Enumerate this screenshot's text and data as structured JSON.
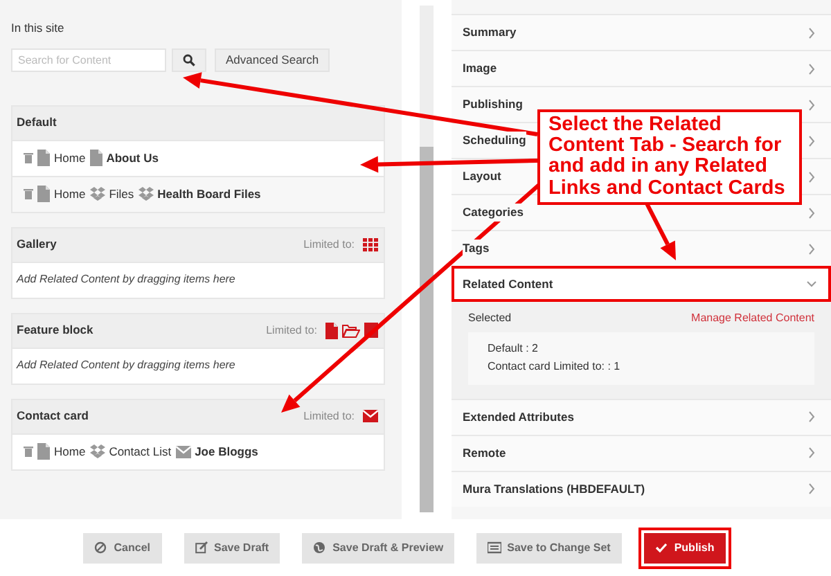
{
  "related_search": {
    "scope_label": "In this site",
    "search": {
      "placeholder": "Search for Content"
    },
    "advanced_button": "Advanced Search"
  },
  "groups": [
    {
      "title": "Default",
      "items": [
        {
          "path": [
            {
              "kind": "page",
              "label": "Home"
            },
            {
              "kind": "page",
              "label": "About Us"
            }
          ]
        },
        {
          "path": [
            {
              "kind": "page",
              "label": "Home"
            },
            {
              "kind": "folder",
              "label": "Files"
            },
            {
              "kind": "folder",
              "label": "Health Board Files"
            }
          ]
        }
      ]
    },
    {
      "title": "Gallery",
      "limited_label": "Limited to:",
      "allowed": [
        {
          "kind": "gallery"
        }
      ],
      "empty_hint": "Add Related Content by dragging items here"
    },
    {
      "title": "Feature block",
      "limited_label": "Limited to:",
      "allowed": [
        {
          "kind": "page"
        },
        {
          "kind": "folder"
        },
        {
          "kind": "file"
        }
      ],
      "empty_hint": "Add Related Content by dragging items here"
    },
    {
      "title": "Contact card",
      "limited_label": "Limited to:",
      "allowed": [
        {
          "kind": "contact"
        }
      ],
      "items": [
        {
          "path": [
            {
              "kind": "page",
              "label": "Home"
            },
            {
              "kind": "folder",
              "label": "Contact List"
            },
            {
              "kind": "contact",
              "label": "Joe Bloggs"
            }
          ]
        }
      ]
    }
  ],
  "sections": [
    {
      "label": "Summary",
      "expanded": false,
      "highlighted": false
    },
    {
      "label": "Image",
      "expanded": false,
      "highlighted": false
    },
    {
      "label": "Publishing",
      "expanded": false,
      "highlighted": false
    },
    {
      "label": "Scheduling",
      "expanded": false,
      "highlighted": false
    },
    {
      "label": "Layout",
      "expanded": false,
      "highlighted": false
    },
    {
      "label": "Categories",
      "expanded": false,
      "highlighted": false
    },
    {
      "label": "Tags",
      "expanded": false,
      "highlighted": false
    },
    {
      "label": "Related Content",
      "expanded": true,
      "highlighted": true,
      "body": {
        "selected_label": "Selected",
        "manage_link": "Manage Related Content",
        "summary_lines": [
          "Default : 2",
          "Contact card Limited to: : 1"
        ]
      }
    },
    {
      "label": "Extended Attributes",
      "expanded": false,
      "highlighted": false
    },
    {
      "label": "Remote",
      "expanded": false,
      "highlighted": false
    },
    {
      "label": "Mura Translations (HBDEFAULT)",
      "expanded": false,
      "highlighted": false
    }
  ],
  "footer_buttons": [
    {
      "kind": "cancel",
      "label": "Cancel",
      "highlighted": false
    },
    {
      "kind": "draft",
      "label": "Save Draft",
      "highlighted": false
    },
    {
      "kind": "preview",
      "label": "Save Draft & Preview",
      "highlighted": false
    },
    {
      "kind": "changeset",
      "label": "Save to Change Set",
      "highlighted": false
    },
    {
      "kind": "publish",
      "label": "Publish",
      "highlighted": true
    }
  ],
  "annotation": {
    "callout": "Select the Related Content Tab - Search for and add in any Related Links and Contact Cards"
  }
}
